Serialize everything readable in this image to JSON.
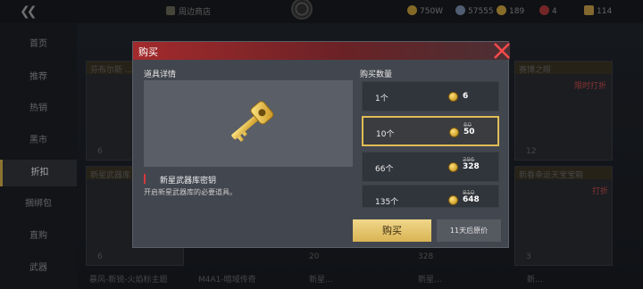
{
  "topbar": {
    "shop_link": "周边商店",
    "currencies": [
      {
        "icon": "gold-coin-icon",
        "value": "750W"
      },
      {
        "icon": "silver-coin-icon",
        "value": "57555"
      },
      {
        "icon": "gold-ticket-icon",
        "value": "189"
      },
      {
        "icon": "red-coupon-icon",
        "value": "4"
      },
      {
        "icon": "trophy-icon",
        "value": "114"
      }
    ]
  },
  "sidebar": {
    "items": [
      {
        "label": "首页"
      },
      {
        "label": "推荐"
      },
      {
        "label": "热销"
      },
      {
        "label": "黑市"
      },
      {
        "label": "折扣"
      },
      {
        "label": "捆绑包"
      },
      {
        "label": "直购"
      },
      {
        "label": "武器"
      }
    ],
    "active_index": 4
  },
  "background_cards": {
    "labels": [
      "芬布尔斯 ...",
      "新星武器库",
      "赛博之眼",
      "新春幸运天宝宝箱",
      "限时打折",
      "打折"
    ],
    "prices": [
      "6",
      "6",
      "12 ",
      "3",
      "20 ",
      "328 "
    ],
    "bottom_labels": [
      "暴风-新锐-火焰标主题",
      "M4A1-暗域传奇",
      "新星...",
      "新星...",
      "新..."
    ]
  },
  "dialog": {
    "title": "购买",
    "detail_label": "道具详情",
    "item_name": "新星武器库密钥",
    "item_desc": "开启新星武器库的必要道具。",
    "qty_label": "购买数量",
    "options": [
      {
        "qty": "1个",
        "old_price": "",
        "price": "6",
        "selected": false
      },
      {
        "qty": "10个",
        "old_price": "60",
        "price": "50",
        "selected": true
      },
      {
        "qty": "66个",
        "old_price": "396",
        "price": "328",
        "selected": false
      },
      {
        "qty": "135个",
        "old_price": "810",
        "price": "648",
        "selected": false
      }
    ],
    "buy_label": "购买",
    "restore_label": "11天后原价"
  },
  "colors": {
    "accent_gold": "#e0bd55",
    "title_red": "#a32a2c",
    "dialog_bg": "#42464e"
  }
}
